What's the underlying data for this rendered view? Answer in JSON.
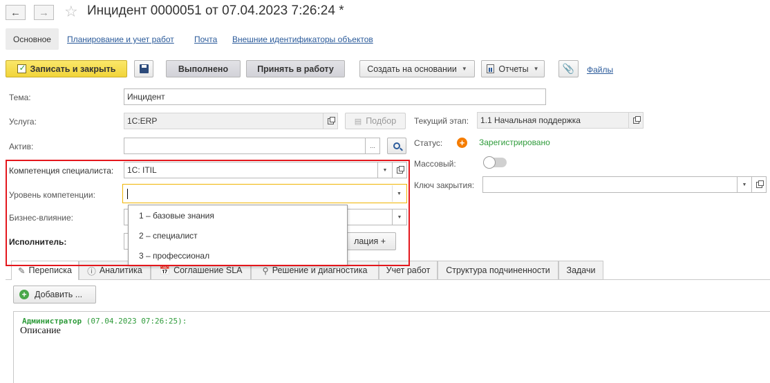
{
  "window": {
    "title": "Инцидент 0000051 от 07.04.2023 7:26:24 *"
  },
  "nav": {
    "active": "Основное",
    "links": [
      "Планирование и учет работ",
      "Почта",
      "Внешние идентификаторы объектов"
    ]
  },
  "toolbar": {
    "save_close": "Записать и закрыть",
    "done": "Выполнено",
    "accept": "Принять в работу",
    "create_based": "Создать на основании",
    "reports": "Отчеты",
    "files": "Файлы"
  },
  "form": {
    "topic_label": "Тема:",
    "topic_value": "Инцидент",
    "service_label": "Услуга:",
    "service_value": "1С:ERP",
    "select_button": "Подбор",
    "asset_label": "Актив:",
    "asset_value": "",
    "ellipsis": "...",
    "competence_label": "Компетенция специалиста:",
    "competence_value": "1C: ITIL",
    "level_label": "Уровень компетенции:",
    "level_value": "",
    "impact_label": "Бизнес-влияние:",
    "executor_label": "Исполнитель:",
    "escalation_partial": "лация +",
    "stage_label": "Текущий этап:",
    "stage_value": "1.1 Начальная поддержка",
    "status_label": "Статус:",
    "status_value": "Зарегистрировано",
    "mass_label": "Массовый:",
    "close_key_label": "Ключ закрытия:",
    "close_key_value": ""
  },
  "dropdown": {
    "options": [
      "1 – базовые знания",
      "2 – специалист",
      "3 – профессионал"
    ]
  },
  "tabs": [
    "Переписка",
    "Аналитика",
    "Соглашение SLA",
    "Решение и диагностика",
    "Учет работ",
    "Структура подчиненности",
    "Задачи"
  ],
  "correspondence": {
    "add_button": "Добавить ...",
    "author": "Администратор",
    "timestamp": "(07.04.2023 07:26:25):",
    "text": "Описание"
  },
  "colors": {
    "accent_yellow": "#f1d43a",
    "highlight_red": "#e4161c",
    "status_green": "#2e9b3a",
    "status_orange": "#f57c00",
    "link_blue": "#2a5a9a"
  }
}
